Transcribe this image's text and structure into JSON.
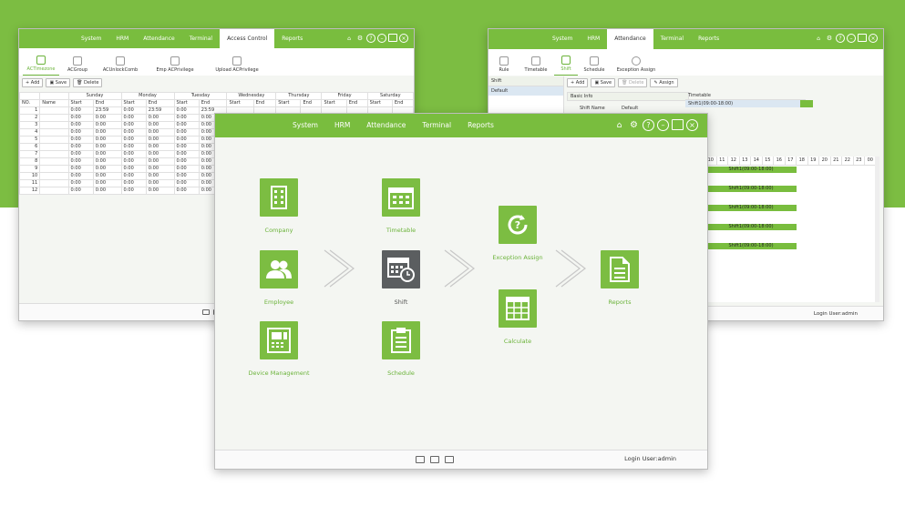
{
  "colors": {
    "accent": "#79bd3e",
    "dark_tile": "#5b5e60",
    "background_band": "#7cbd42"
  },
  "menu": [
    "System",
    "HRM",
    "Attendance",
    "Terminal",
    "Reports"
  ],
  "menu_access": [
    "System",
    "HRM",
    "Attendance",
    "Terminal",
    "Access Control",
    "Reports"
  ],
  "login": "Login User:admin",
  "left_window": {
    "subtabs": [
      "ACTimezone",
      "ACGroup",
      "ACUnlockComb",
      "Emp ACPrivilege",
      "Upload ACPrivilege"
    ],
    "toolbar": [
      "Add",
      "Save",
      "Delete"
    ],
    "columns": {
      "no": "NO.",
      "name": "Name",
      "days": [
        "Sunday",
        "Monday",
        "Tuesday",
        "Wednesday",
        "Thursday",
        "Friday",
        "Saturday"
      ],
      "start": "Start",
      "end": "End"
    },
    "rows": [
      {
        "no": "1",
        "cells": [
          "0:00",
          "23:59",
          "0:00",
          "23:59",
          "0:00",
          "23:59"
        ]
      },
      {
        "no": "2",
        "cells": [
          "0:00",
          "0:00",
          "0:00",
          "0:00",
          "0:00",
          "0:00"
        ]
      },
      {
        "no": "3",
        "cells": [
          "0:00",
          "0:00",
          "0:00",
          "0:00",
          "0:00",
          "0:00"
        ]
      },
      {
        "no": "4",
        "cells": [
          "0:00",
          "0:00",
          "0:00",
          "0:00",
          "0:00",
          "0:00"
        ]
      },
      {
        "no": "5",
        "cells": [
          "0:00",
          "0:00",
          "0:00",
          "0:00",
          "0:00",
          "0:00"
        ]
      },
      {
        "no": "6",
        "cells": [
          "0:00",
          "0:00",
          "0:00",
          "0:00",
          "0:00",
          "0:00"
        ]
      },
      {
        "no": "7",
        "cells": [
          "0:00",
          "0:00",
          "0:00",
          "0:00",
          "0:00",
          "0:00"
        ]
      },
      {
        "no": "8",
        "cells": [
          "0:00",
          "0:00",
          "0:00",
          "0:00",
          "0:00",
          "0:00"
        ]
      },
      {
        "no": "9",
        "cells": [
          "0:00",
          "0:00",
          "0:00",
          "0:00",
          "0:00",
          "0:00"
        ]
      },
      {
        "no": "10",
        "cells": [
          "0:00",
          "0:00",
          "0:00",
          "0:00",
          "0:00",
          "0:00"
        ]
      },
      {
        "no": "11",
        "cells": [
          "0:00",
          "0:00",
          "0:00",
          "0:00",
          "0:00",
          "0:00"
        ]
      },
      {
        "no": "12",
        "cells": [
          "0:00",
          "0:00",
          "0:00",
          "0:00",
          "0:00",
          "0:00"
        ]
      }
    ]
  },
  "right_window": {
    "subtabs": [
      "Rule",
      "Timetable",
      "Shift",
      "Schedule",
      "Exception Assign"
    ],
    "toolbar": [
      "Add",
      "Save",
      "Delete",
      "Assign"
    ],
    "shift_list_header": "Shift",
    "shift_list_item": "Default",
    "basic_info": "Basic Info",
    "shift_name_label": "Shift Name",
    "shift_name_value": "Default",
    "timetable_header": "Timetable",
    "timetable_item": "Shift1(09:00-18:00)",
    "hours": [
      "10",
      "11",
      "12",
      "13",
      "14",
      "15",
      "16",
      "17",
      "18",
      "19",
      "20",
      "21",
      "22",
      "23",
      "00"
    ],
    "bar_label": "Shift1(09:00-18:00)"
  },
  "main_window": {
    "flow": [
      {
        "label": "Company"
      },
      {
        "label": "Employee"
      },
      {
        "label": "Device Management"
      },
      {
        "label": "Timetable"
      },
      {
        "label": "Shift"
      },
      {
        "label": "Schedule"
      },
      {
        "label": "Exception Assign"
      },
      {
        "label": "Calculate"
      },
      {
        "label": "Reports"
      }
    ]
  }
}
